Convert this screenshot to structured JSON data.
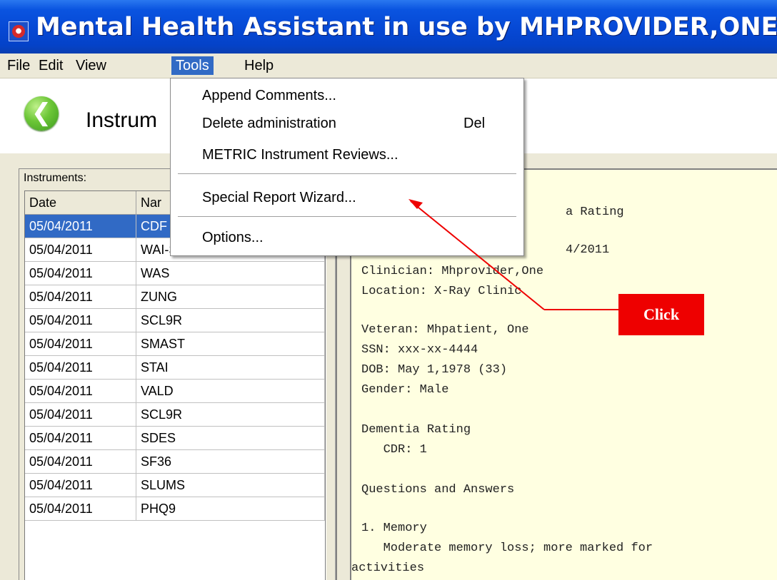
{
  "window": {
    "title": "Mental Health Assistant in use by MHPROVIDER,ONE"
  },
  "menubar": [
    "File",
    "Edit",
    "View",
    "Tools",
    "Help"
  ],
  "header": {
    "page_title": "Instrum"
  },
  "tools_menu": {
    "items": [
      {
        "label": "Append Comments...",
        "shortcut": ""
      },
      {
        "label": "Delete administration",
        "shortcut": "Del"
      },
      {
        "label": "METRIC Instrument Reviews...",
        "shortcut": ""
      },
      {
        "label": "Special Report Wizard...",
        "shortcut": ""
      },
      {
        "label": "Options...",
        "shortcut": ""
      }
    ]
  },
  "instruments": {
    "label": "Instruments:",
    "columns": [
      "Date",
      "Nar"
    ],
    "rows": [
      {
        "date": "05/04/2011",
        "name": "CDF",
        "selected": true
      },
      {
        "date": "05/04/2011",
        "name": "WAI-SR",
        "selected": false
      },
      {
        "date": "05/04/2011",
        "name": "WAS",
        "selected": false
      },
      {
        "date": "05/04/2011",
        "name": "ZUNG",
        "selected": false
      },
      {
        "date": "05/04/2011",
        "name": "SCL9R",
        "selected": false
      },
      {
        "date": "05/04/2011",
        "name": "SMAST",
        "selected": false
      },
      {
        "date": "05/04/2011",
        "name": "STAI",
        "selected": false
      },
      {
        "date": "05/04/2011",
        "name": "VALD",
        "selected": false
      },
      {
        "date": "05/04/2011",
        "name": "SCL9R",
        "selected": false
      },
      {
        "date": "05/04/2011",
        "name": "SDES",
        "selected": false
      },
      {
        "date": "05/04/2011",
        "name": "SF36",
        "selected": false
      },
      {
        "date": "05/04/2011",
        "name": "SLUMS",
        "selected": false
      },
      {
        "date": "05/04/2011",
        "name": "PHQ9",
        "selected": false
      }
    ]
  },
  "report": {
    "lines": [
      {
        "indent": 1,
        "text": "a Rating"
      },
      {
        "indent": 1,
        "text": "4/2011"
      },
      {
        "indent": 0,
        "text": "Clinician: Mhprovider,One"
      },
      {
        "indent": 0,
        "text": "Location: X-Ray Clinic"
      },
      {
        "indent": 0,
        "text": "Veteran: Mhpatient, One"
      },
      {
        "indent": 0,
        "text": "SSN: xxx-xx-4444"
      },
      {
        "indent": 0,
        "text": "DOB: May 1,1978 (33)"
      },
      {
        "indent": 0,
        "text": "Gender: Male"
      },
      {
        "indent": 0,
        "text": "Dementia Rating"
      },
      {
        "indent": 0,
        "text": "   CDR: 1"
      },
      {
        "indent": 0,
        "text": "Questions and Answers"
      },
      {
        "indent": 0,
        "text": "1. Memory"
      },
      {
        "indent": 0,
        "text": "   Moderate memory loss; more marked for"
      },
      {
        "indent": -1,
        "text": "activities"
      }
    ]
  },
  "annotation": {
    "callout_text": "Click",
    "color": "#ee0000"
  }
}
